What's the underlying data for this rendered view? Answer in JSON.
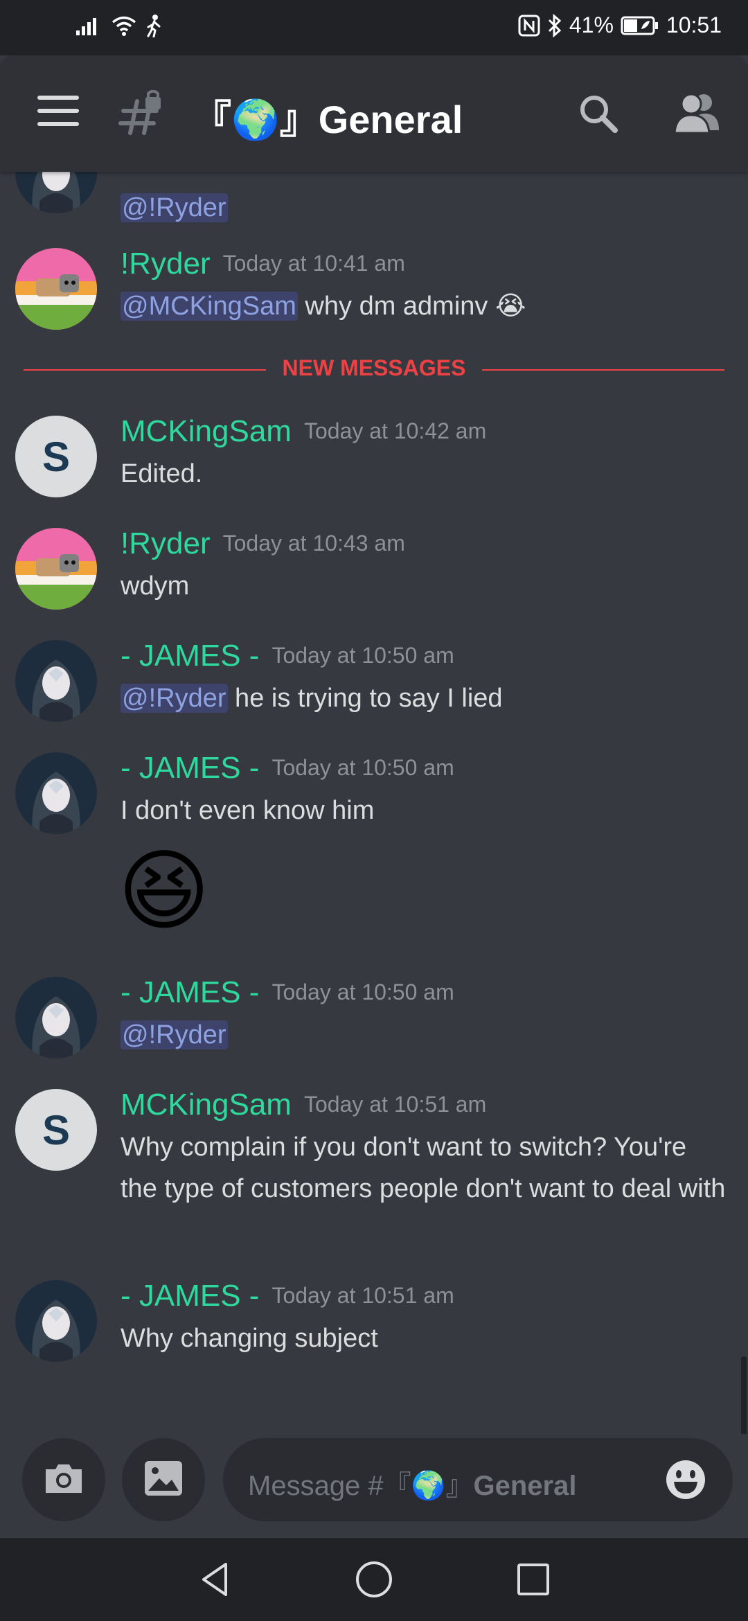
{
  "status_bar": {
    "battery": "41%",
    "time": "10:51"
  },
  "header": {
    "channel_title": "『🌍』General"
  },
  "divider": {
    "label": "NEW MESSAGES"
  },
  "messages": [
    {
      "text_parts": {
        "mention": "@!Ryder"
      }
    },
    {
      "author": "!Ryder",
      "time": "Today at 10:41 am",
      "mention": "@MCKingSam",
      "text": " why dm adminv 😭"
    },
    {
      "author": "MCKingSam",
      "time": "Today at 10:42 am",
      "text": "Edited."
    },
    {
      "author": "!Ryder",
      "time": "Today at 10:43 am",
      "text": "wdym"
    },
    {
      "author": "- JAMES -",
      "time": "Today at 10:50 am",
      "mention": "@!Ryder",
      "text": " he is trying to say I lied"
    },
    {
      "author": "- JAMES -",
      "time": "Today at 10:50 am",
      "text": "I don't even know him",
      "emoji": "😆"
    },
    {
      "author": "- JAMES -",
      "time": "Today at 10:50 am",
      "mention": "@!Ryder"
    },
    {
      "author": "MCKingSam",
      "time": "Today at 10:51 am",
      "text": "Why complain if you don't want to switch? You're the type of customers people don't want to deal with"
    },
    {
      "author": "- JAMES -",
      "time": "Today at 10:51 am",
      "text": "Why changing subject"
    }
  ],
  "composer": {
    "placeholder_prefix": "Message #『🌍』",
    "placeholder_channel": "General"
  },
  "avatar_letter": "S",
  "colors": {
    "background": "#36393f",
    "topbar": "#2f3136",
    "username": "#2fd89c",
    "mention_text": "#8ea1e1",
    "new_messages": "#ed4245",
    "timestamp": "#8e9297"
  }
}
